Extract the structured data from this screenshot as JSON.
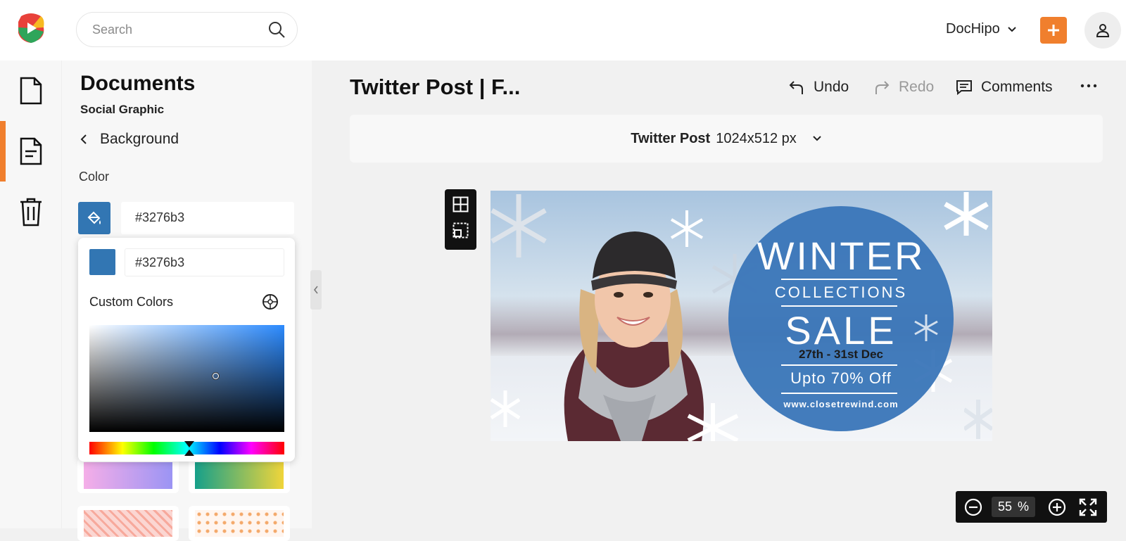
{
  "header": {
    "search_placeholder": "Search",
    "account_menu_label": "DocHipo",
    "accent_color": "#f07f2d"
  },
  "rail": {
    "items": [
      {
        "icon": "document-icon",
        "active": false
      },
      {
        "icon": "text-document-icon",
        "active": true
      },
      {
        "icon": "trash-icon",
        "active": false
      }
    ]
  },
  "panel": {
    "title": "Documents",
    "subtitle": "Social Graphic",
    "back_label": "Background",
    "color_label": "Color",
    "color_value": "#3276b3",
    "picker": {
      "hex_value": "#3276b3",
      "custom_colors_label": "Custom Colors"
    },
    "gradient_tiles": [
      {
        "from": "#f5aee8",
        "to": "#9b94f4"
      },
      {
        "from": "#16a08a",
        "to": "#f0d53a"
      }
    ]
  },
  "editor": {
    "doc_title": "Twitter Post | F...",
    "undo_label": "Undo",
    "redo_label": "Redo",
    "comments_label": "Comments",
    "size_name": "Twitter Post",
    "size_dims": "1024x512 px"
  },
  "design": {
    "headline": "WINTER",
    "subhead": "COLLECTIONS",
    "sale": "SALE",
    "dates": "27th - 31st Dec",
    "offer": "Upto 70% Off",
    "url": "www.closetrewind.com",
    "circle_color": "#3a76b9"
  },
  "zoom": {
    "value": "55",
    "unit": "%"
  }
}
